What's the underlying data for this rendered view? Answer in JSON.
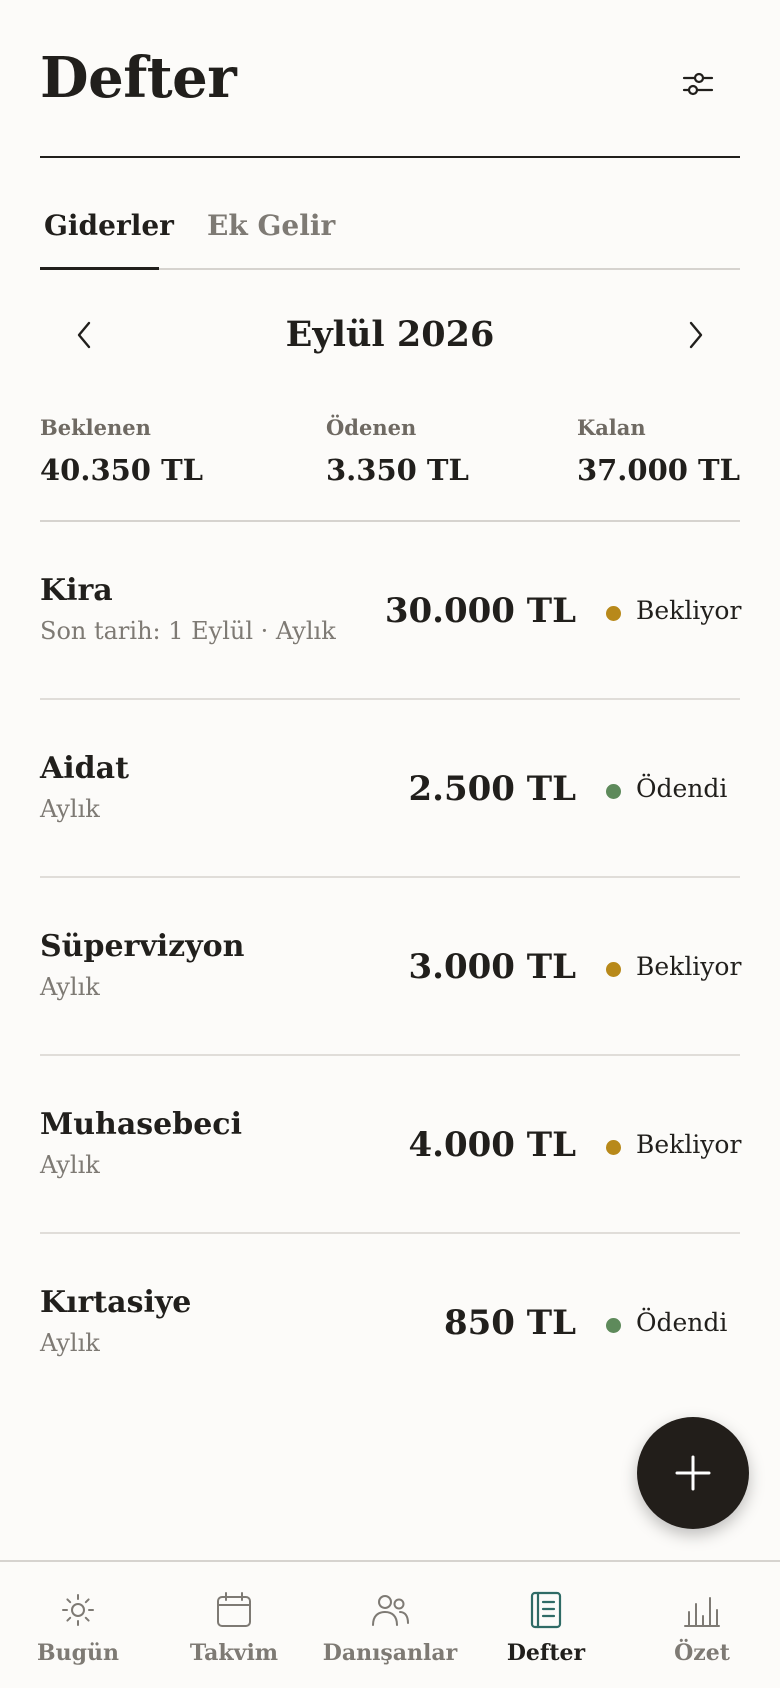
{
  "header": {
    "title": "Defter"
  },
  "tabs": [
    {
      "label": "Giderler",
      "active": true
    },
    {
      "label": "Ek Gelir",
      "active": false
    }
  ],
  "month_nav": {
    "label": "Eylül 2026"
  },
  "summary": {
    "expected_label": "Beklenen",
    "expected_value": "40.350 TL",
    "paid_label": "Ödenen",
    "paid_value": "3.350 TL",
    "remaining_label": "Kalan",
    "remaining_value": "37.000 TL"
  },
  "colors": {
    "pending": "#b8891a",
    "paid": "#5e8a5b",
    "accent": "#2f6b66",
    "fab": "#221e1a"
  },
  "expenses": [
    {
      "name": "Kira",
      "sub": "Son tarih: 1 Eylül · Aylık",
      "amount": "30.000 TL",
      "status": "Bekliyor",
      "status_color": "#b8891a"
    },
    {
      "name": "Aidat",
      "sub": "Aylık",
      "amount": "2.500 TL",
      "status": "Ödendi",
      "status_color": "#5e8a5b"
    },
    {
      "name": "Süpervizyon",
      "sub": "Aylık",
      "amount": "3.000 TL",
      "status": "Bekliyor",
      "status_color": "#b8891a"
    },
    {
      "name": "Muhasebeci",
      "sub": "Aylık",
      "amount": "4.000 TL",
      "status": "Bekliyor",
      "status_color": "#b8891a"
    },
    {
      "name": "Kırtasiye",
      "sub": "Aylık",
      "amount": "850 TL",
      "status": "Ödendi",
      "status_color": "#5e8a5b"
    }
  ],
  "fab": {
    "icon": "plus-icon"
  },
  "bottom_nav": [
    {
      "label": "Bugün",
      "icon": "sun-icon",
      "active": false
    },
    {
      "label": "Takvim",
      "icon": "calendar-icon",
      "active": false
    },
    {
      "label": "Danışanlar",
      "icon": "users-icon",
      "active": false
    },
    {
      "label": "Defter",
      "icon": "ledger-icon",
      "active": true
    },
    {
      "label": "Özet",
      "icon": "bar-chart-icon",
      "active": false
    }
  ]
}
